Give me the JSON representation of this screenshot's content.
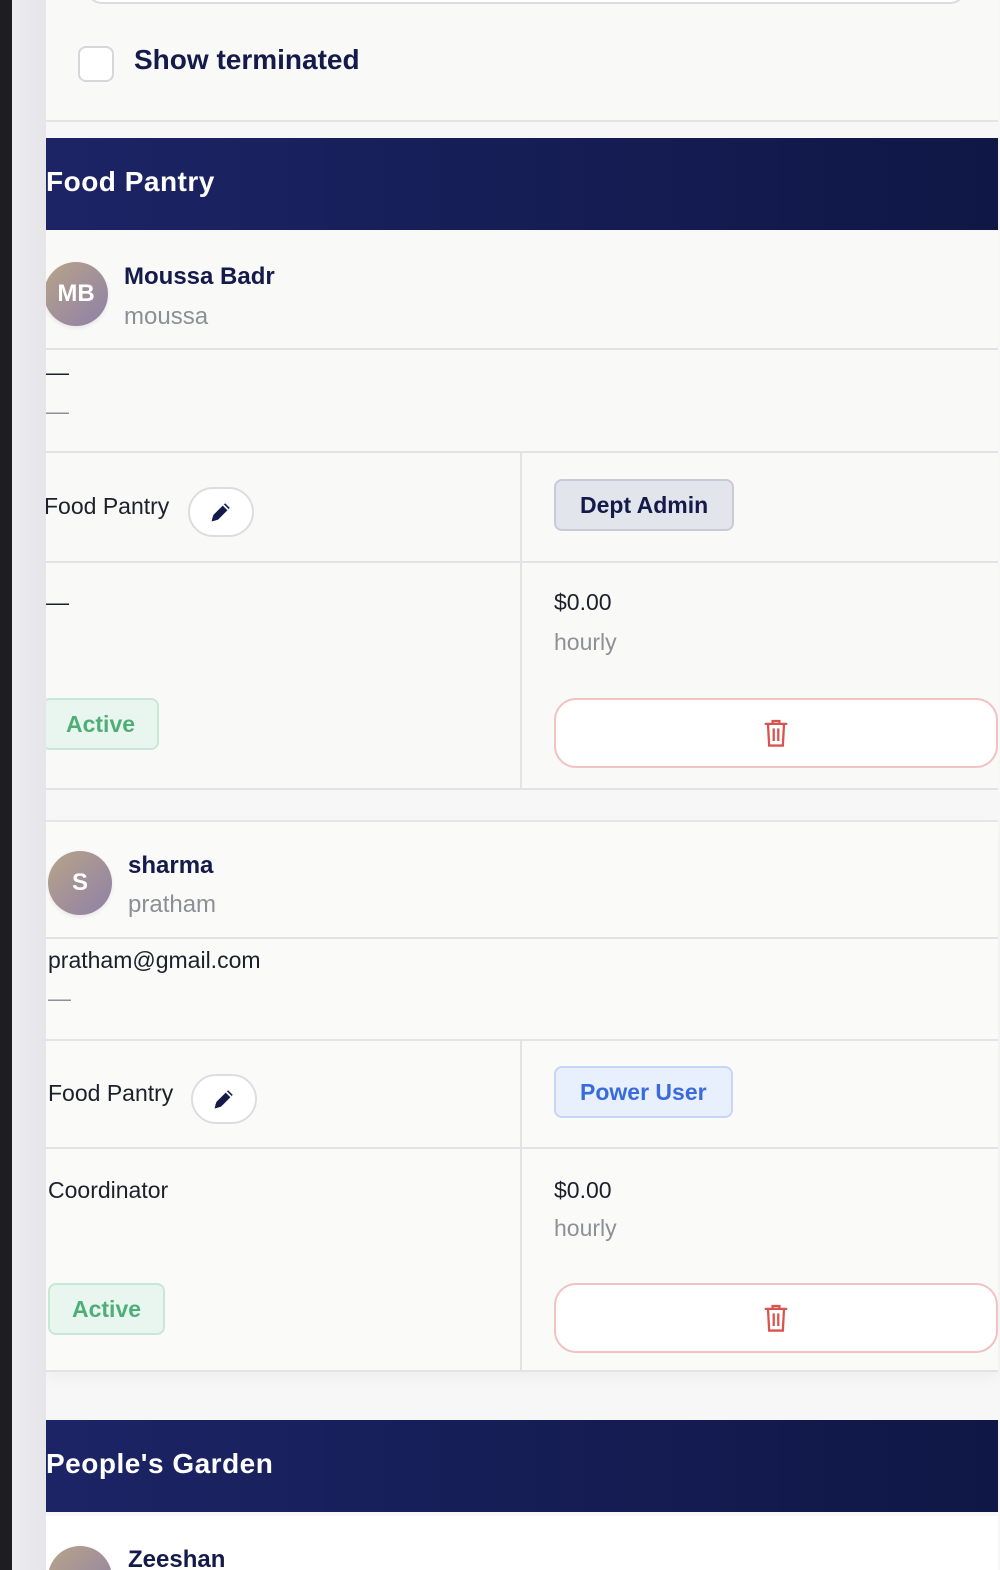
{
  "filters": {
    "show_terminated_label": "Show terminated",
    "show_terminated_checked": false
  },
  "sections": [
    {
      "title": "Food Pantry",
      "members": [
        {
          "initials": "MB",
          "name": "Moussa Badr",
          "username": "moussa",
          "email": "—",
          "phone": "—",
          "department": "Food Pantry",
          "role": "Dept Admin",
          "position": "—",
          "pay_rate": "$0.00",
          "pay_type": "hourly",
          "status": "Active"
        },
        {
          "initials": "S",
          "name": "sharma",
          "username": "pratham",
          "email": "pratham@gmail.com",
          "phone": "—",
          "department": "Food Pantry",
          "role": "Power User",
          "position": "Coordinator",
          "pay_rate": "$0.00",
          "pay_type": "hourly",
          "status": "Active"
        }
      ]
    },
    {
      "title": "People's Garden",
      "members": [
        {
          "name": "Zeeshan"
        }
      ]
    }
  ],
  "icons": {
    "edit": "pencil-icon",
    "delete": "trash-icon"
  },
  "colors": {
    "header_bg": "#1c2466",
    "active_green": "#4fae78",
    "power_user_blue": "#3a6bdc",
    "delete_red": "#d9534f"
  }
}
